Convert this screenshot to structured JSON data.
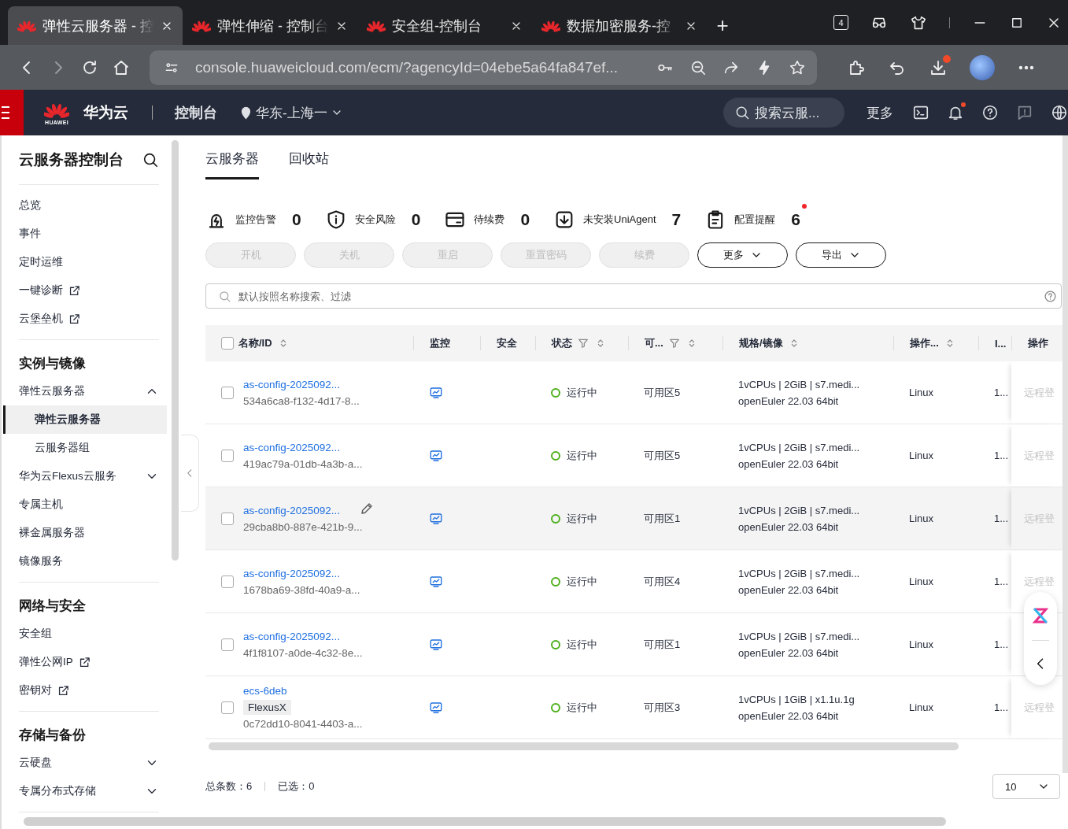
{
  "browser": {
    "tabs": [
      {
        "title": "弹性云服务器 - 控",
        "selected": true
      },
      {
        "title": "弹性伸缩 - 控制台",
        "selected": false
      },
      {
        "title": "安全组-控制台",
        "selected": false
      },
      {
        "title": "数据加密服务-控",
        "selected": false
      }
    ],
    "new_tab": "+",
    "tab_count": "4",
    "url": "console.huaweicloud.com/ecm/?agencyId=04ebe5a64fa847ef..."
  },
  "header": {
    "logo_text": "HUAWEI",
    "brand": "华为云",
    "console": "控制台",
    "region": "华东-上海一",
    "search_placeholder": "搜索云服...",
    "more": "更多"
  },
  "sidebar": {
    "title": "云服务器控制台",
    "groups": [
      {
        "items": [
          {
            "label": "总览",
            "selected": false,
            "external": false
          },
          {
            "label": "事件",
            "selected": false,
            "external": false
          },
          {
            "label": "定时运维",
            "selected": false,
            "external": false
          },
          {
            "label": "一键诊断",
            "selected": false,
            "external": true
          },
          {
            "label": "云堡垒机",
            "selected": false,
            "external": true
          }
        ]
      },
      {
        "title": "实例与镜像",
        "items": [
          {
            "label": "弹性云服务器",
            "selected": false,
            "external": false,
            "expanded": true,
            "children": [
              {
                "label": "弹性云服务器",
                "selected": true,
                "external": false
              },
              {
                "label": "云服务器组",
                "selected": false,
                "external": false
              }
            ]
          },
          {
            "label": "华为云Flexus云服务",
            "selected": false,
            "external": false,
            "expanded": false
          },
          {
            "label": "专属主机",
            "selected": false,
            "external": false
          },
          {
            "label": "裸金属服务器",
            "selected": false,
            "external": false
          },
          {
            "label": "镜像服务",
            "selected": false,
            "external": false
          }
        ]
      },
      {
        "title": "网络与安全",
        "items": [
          {
            "label": "安全组",
            "selected": false,
            "external": false
          },
          {
            "label": "弹性公网IP",
            "selected": false,
            "external": true
          },
          {
            "label": "密钥对",
            "selected": false,
            "external": true
          }
        ]
      },
      {
        "title": "存储与备份",
        "items": [
          {
            "label": "云硬盘",
            "selected": false,
            "external": false,
            "expanded": false
          },
          {
            "label": "专属分布式存储",
            "selected": false,
            "external": false,
            "expanded": false
          }
        ]
      }
    ]
  },
  "tabs": [
    {
      "label": "云服务器",
      "selected": true
    },
    {
      "label": "回收站",
      "selected": false
    }
  ],
  "stats": [
    {
      "kind": "alarm",
      "label": "监控告警",
      "count": "0",
      "alert": false
    },
    {
      "kind": "risk",
      "label": "安全风险",
      "count": "0",
      "alert": false
    },
    {
      "kind": "renew",
      "label": "待续费",
      "count": "0",
      "alert": false
    },
    {
      "kind": "agent",
      "label": "未安装UniAgent",
      "count": "7",
      "alert": false
    },
    {
      "kind": "config",
      "label": "配置提醒",
      "count": "6",
      "alert": true
    }
  ],
  "actions": [
    {
      "label": "开机",
      "disabled": true,
      "dropdown": false
    },
    {
      "label": "关机",
      "disabled": true,
      "dropdown": false
    },
    {
      "label": "重启",
      "disabled": true,
      "dropdown": false
    },
    {
      "label": "重置密码",
      "disabled": true,
      "dropdown": false
    },
    {
      "label": "续费",
      "disabled": true,
      "dropdown": false
    },
    {
      "label": "更多",
      "disabled": false,
      "dropdown": true
    },
    {
      "label": "导出",
      "disabled": false,
      "dropdown": true
    }
  ],
  "search": {
    "placeholder": "默认按照名称搜索、过滤"
  },
  "table": {
    "select_all": false,
    "columns": [
      {
        "label": "名称/ID",
        "sortable": true,
        "filterable": false
      },
      {
        "label": "监控",
        "sortable": false,
        "filterable": false
      },
      {
        "label": "安全",
        "sortable": false,
        "filterable": false
      },
      {
        "label": "状态",
        "sortable": true,
        "filterable": true
      },
      {
        "label": "可...",
        "sortable": true,
        "filterable": true
      },
      {
        "label": "规格/镜像",
        "sortable": true,
        "filterable": false
      },
      {
        "label": "操作...",
        "sortable": true,
        "filterable": false
      },
      {
        "label": "I...",
        "sortable": false,
        "filterable": false
      },
      {
        "label": "操作",
        "sortable": false,
        "filterable": false
      }
    ],
    "rows": [
      {
        "name": "as-config-2025092...",
        "id": "534a6ca8-f132-4d17-8...",
        "status": "运行中",
        "zone": "可用区5",
        "spec": "1vCPUs | 2GiB | s7.medi...",
        "image": "openEuler 22.03 64bit",
        "os": "Linux",
        "column_8": "1...",
        "action": "远程登",
        "selected": false,
        "highlighted": false
      },
      {
        "name": "as-config-2025092...",
        "id": "419ac79a-01db-4a3b-a...",
        "status": "运行中",
        "zone": "可用区5",
        "spec": "1vCPUs | 2GiB | s7.medi...",
        "image": "openEuler 22.03 64bit",
        "os": "Linux",
        "column_8": "1...",
        "action": "远程登",
        "selected": false,
        "highlighted": false
      },
      {
        "name": "as-config-2025092...",
        "id": "29cba8b0-887e-421b-9...",
        "status": "运行中",
        "zone": "可用区1",
        "spec": "1vCPUs | 2GiB | s7.medi...",
        "image": "openEuler 22.03 64bit",
        "os": "Linux",
        "column_8": "1...",
        "action": "远程登",
        "selected": false,
        "highlighted": true
      },
      {
        "name": "as-config-2025092...",
        "id": "1678ba69-38fd-40a9-a...",
        "status": "运行中",
        "zone": "可用区4",
        "spec": "1vCPUs | 2GiB | s7.medi...",
        "image": "openEuler 22.03 64bit",
        "os": "Linux",
        "column_8": "1...",
        "action": "远程登",
        "selected": false,
        "highlighted": false
      },
      {
        "name": "as-config-2025092...",
        "id": "4f1f8107-a0de-4c32-8e...",
        "status": "运行中",
        "zone": "可用区1",
        "spec": "1vCPUs | 2GiB | s7.medi...",
        "image": "openEuler 22.03 64bit",
        "os": "Linux",
        "column_8": "1...",
        "selected": false,
        "highlighted": false
      },
      {
        "name": "ecs-6deb",
        "tag": "FlexusX",
        "id": "0c72dd10-8041-4403-a...",
        "status": "运行中",
        "zone": "可用区3",
        "spec": "1vCPUs | 1GiB | x1.1u.1g",
        "image": "openEuler 22.03 64bit",
        "os": "Linux",
        "column_8": "1...",
        "action": "远程登",
        "selected": false,
        "highlighted": false
      }
    ]
  },
  "footer": {
    "total": "总条数：6",
    "selected": "已选：0",
    "page_size": "10"
  }
}
